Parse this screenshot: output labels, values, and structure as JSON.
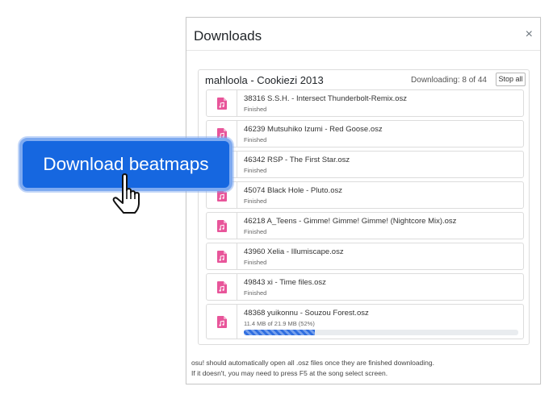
{
  "modal": {
    "title": "Downloads",
    "close_symbol": "×"
  },
  "card": {
    "title": "mahloola - Cookiezi 2013",
    "status": "Downloading: 8 of 44",
    "stop_label": "Stop all"
  },
  "items": [
    {
      "name": "38316 S.S.H. - Intersect Thunderbolt-Remix.osz",
      "status": "Finished",
      "icon": "file-music-icon"
    },
    {
      "name": "46239 Mutsuhiko Izumi - Red Goose.osz",
      "status": "Finished",
      "icon": "file-music-icon"
    },
    {
      "name": "46342 RSP - The First Star.osz",
      "status": "Finished",
      "icon": "file-music-icon"
    },
    {
      "name": "45074 Black Hole - Pluto.osz",
      "status": "Finished",
      "icon": "file-music-icon"
    },
    {
      "name": "46218 A_Teens - Gimme! Gimme! Gimme! (Nightcore Mix).osz",
      "status": "Finished",
      "icon": "file-music-icon"
    },
    {
      "name": "43960 Xelia - Illumiscape.osz",
      "status": "Finished",
      "icon": "file-music-icon"
    },
    {
      "name": "49843 xi - Time files.osz",
      "status": "Finished",
      "icon": "file-music-icon"
    },
    {
      "name": "48368 yuikonnu - Souzou Forest.osz",
      "status": "11.4 MB of 21.9 MB (52%)",
      "icon": "file-music-icon",
      "progress": 0.26
    }
  ],
  "footer": {
    "line1": "osu! should automatically open all .osz files once they are finished downloading.",
    "line2": "If it doesn't, you may need to press F5 at the song select screen."
  },
  "overlay": {
    "button_label": "Download beatmaps"
  },
  "colors": {
    "accent": "#1667e0",
    "icon_pink": "#e8559a",
    "progress": "#2f6ee0"
  }
}
